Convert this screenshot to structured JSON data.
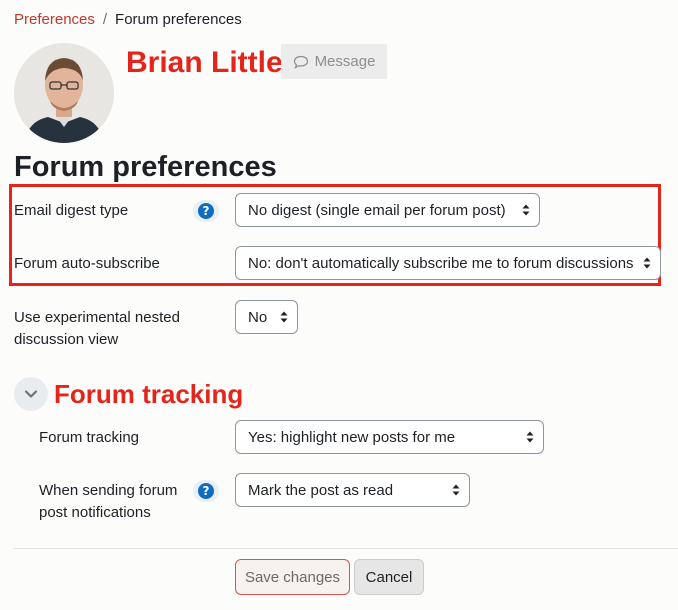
{
  "breadcrumb": {
    "link": "Preferences",
    "separator": "/",
    "current": "Forum preferences"
  },
  "profile": {
    "name": "Brian Little",
    "message_label": "Message"
  },
  "page_title": "Forum preferences",
  "fields": {
    "email_digest": {
      "label": "Email digest type",
      "value": "No digest (single email per forum post)"
    },
    "auto_subscribe": {
      "label": "Forum auto-subscribe",
      "value": "No: don't automatically subscribe me to forum discussions"
    },
    "nested_view": {
      "label_line1": "Use experimental nested",
      "label_line2": "discussion view",
      "value": "No"
    }
  },
  "tracking_section": {
    "title": "Forum tracking",
    "forum_tracking": {
      "label": "Forum tracking",
      "value": "Yes: highlight new posts for me"
    },
    "notifications": {
      "label_line1": "When sending forum",
      "label_line2": "post notifications",
      "value": "Mark the post as read"
    }
  },
  "help_glyph": "?",
  "actions": {
    "save": "Save changes",
    "cancel": "Cancel"
  },
  "colors": {
    "accent_red": "#e3251b",
    "link_red": "#c0392b",
    "help_blue": "#0f6cbf"
  }
}
